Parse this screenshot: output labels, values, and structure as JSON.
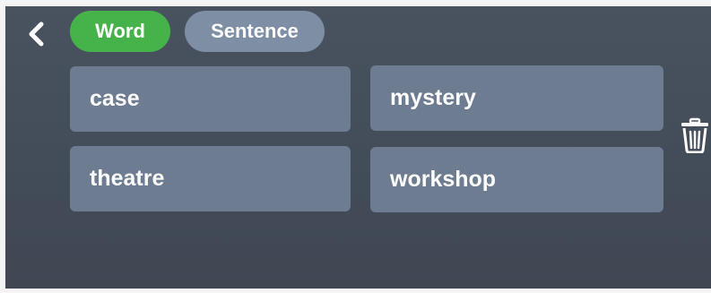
{
  "header": {
    "back_icon": "chevron-left-icon",
    "tabs": [
      {
        "label": "Word",
        "active": true
      },
      {
        "label": "Sentence",
        "active": false
      }
    ]
  },
  "words": [
    {
      "label": "case"
    },
    {
      "label": "mystery"
    },
    {
      "label": "theatre"
    },
    {
      "label": "workshop"
    }
  ],
  "actions": {
    "delete_icon": "trash-icon"
  },
  "colors": {
    "background": "#47505d",
    "tab_active": "#46b34a",
    "tab_inactive": "#7d8ea5",
    "card": "#6d7c90",
    "text": "#ffffff"
  }
}
